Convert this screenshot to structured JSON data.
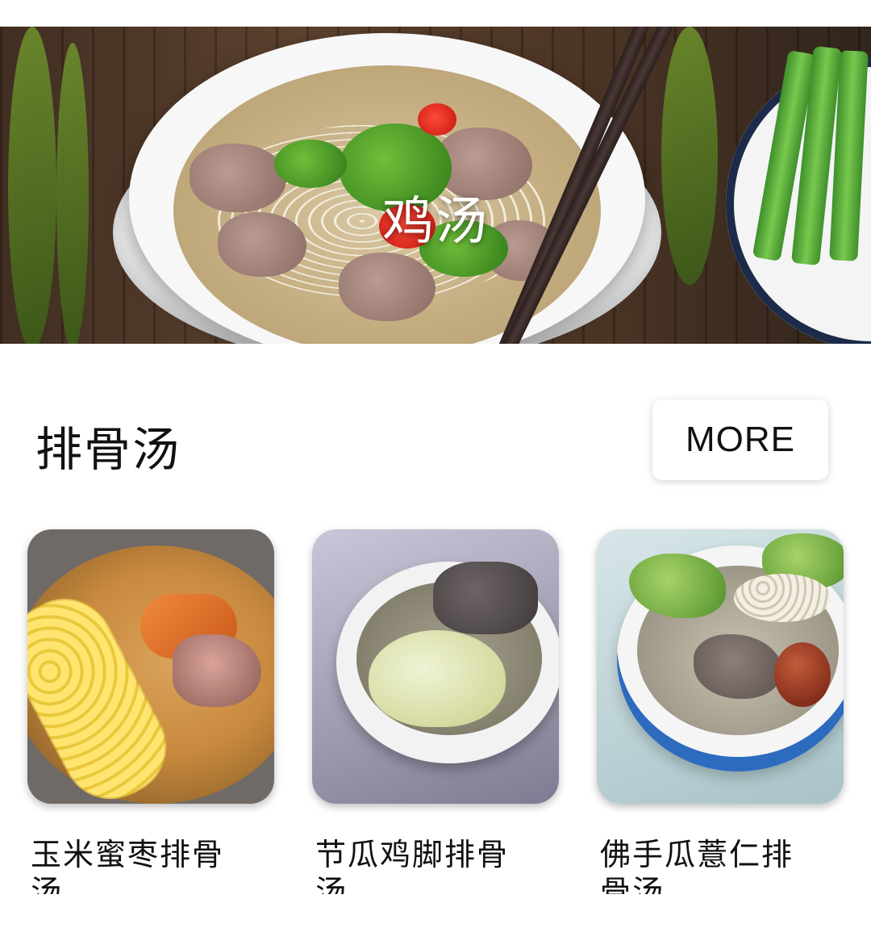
{
  "hero": {
    "title": "鸡汤"
  },
  "section": {
    "title": "排骨汤",
    "more_label": "MORE"
  },
  "cards": [
    {
      "title": "玉米蜜枣排骨汤"
    },
    {
      "title": "节瓜鸡脚排骨汤"
    },
    {
      "title": "佛手瓜薏仁排骨汤"
    }
  ],
  "colors": {
    "background": "#ffffff",
    "text": "#111111",
    "button_bg": "#ffffff"
  }
}
